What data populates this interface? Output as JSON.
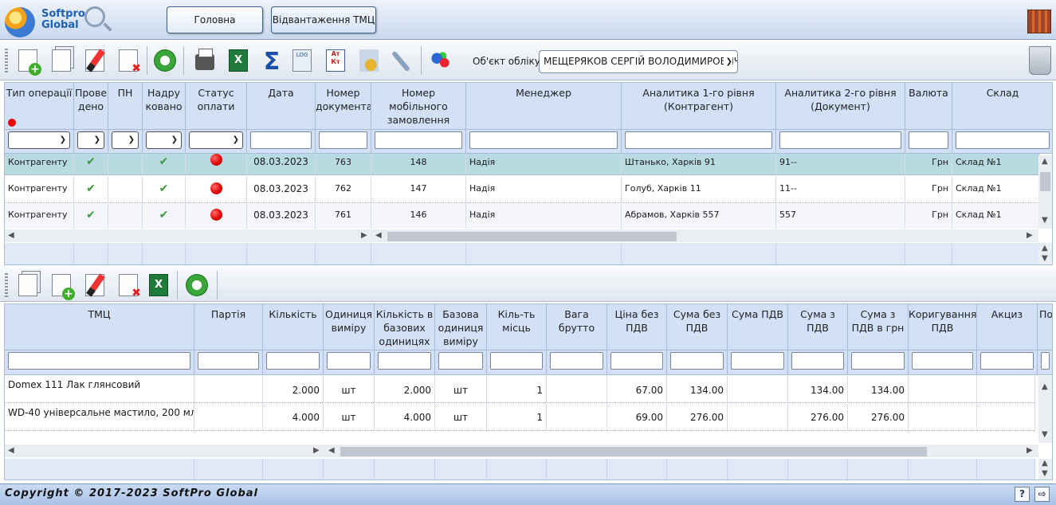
{
  "header": {
    "logo_line1": "Softpro",
    "logo_line2": "Global",
    "tabs": [
      {
        "label": "Головна"
      },
      {
        "label": "Відвантаження ТМЦ"
      }
    ]
  },
  "object_selector": {
    "label": "Об'єкт обліку",
    "value": "МЕЩЕРЯКОВ СЕРГІЙ ВОЛОДИМИРОВИЧ"
  },
  "grid1": {
    "columns": [
      "Тип операції",
      "Прове дено",
      "ПН",
      "Надру ковано",
      "Статус оплати",
      "Дата",
      "Номер документа",
      "Номер мобільного замовлення",
      "Менеджер",
      "Аналитика 1-го рівня (Контрагент)",
      "Аналитика 2-го рівня (Документ)",
      "Валюта",
      "Склад"
    ],
    "rows": [
      {
        "type": "Контрагенту",
        "date": "08.03.2023",
        "doc_no": "763",
        "mobile_no": "148",
        "manager": "Надія",
        "analytics1": "Штанько, Харків 91",
        "analytics2": "91--",
        "currency": "Грн",
        "warehouse": "Склад №1"
      },
      {
        "type": "Контрагенту",
        "date": "08.03.2023",
        "doc_no": "762",
        "mobile_no": "147",
        "manager": "Надія",
        "analytics1": "Голуб, Харків 11",
        "analytics2": "11--",
        "currency": "Грн",
        "warehouse": "Склад №1"
      },
      {
        "type": "Контрагенту",
        "date": "08.03.2023",
        "doc_no": "761",
        "mobile_no": "146",
        "manager": "Надія",
        "analytics1": "Абрамов, Харків 557",
        "analytics2": "557",
        "currency": "Грн",
        "warehouse": "Склад №1"
      }
    ]
  },
  "grid2": {
    "columns": [
      "ТМЦ",
      "Партія",
      "Кількість",
      "Одиниця виміру",
      "Кількість в базових одиницях",
      "Базова одиниця виміру",
      "Кіль-ть місць",
      "Вага брутто",
      "Ціна без ПДВ",
      "Сума без ПДВ",
      "Сума ПДВ",
      "Сума з ПДВ",
      "Сума з ПДВ в грн",
      "Коригування ПДВ",
      "Акциз",
      "По"
    ],
    "rows": [
      {
        "item": "Domex 111 Лак глянсовий",
        "qty": "2.000",
        "unit": "шт",
        "base_qty": "2.000",
        "base_unit": "шт",
        "places": "1",
        "price": "67.00",
        "sum_no_vat": "134.00",
        "sum_vat": "134.00",
        "sum_vat_uah": "134.00"
      },
      {
        "item": "WD-40 універсальне мастило, 200 мл",
        "qty": "4.000",
        "unit": "шт",
        "base_qty": "4.000",
        "base_unit": "шт",
        "places": "1",
        "price": "69.00",
        "sum_no_vat": "276.00",
        "sum_vat": "276.00",
        "sum_vat_uah": "276.00"
      }
    ]
  },
  "footer": {
    "copyright": "Copyright © 2017-2023 SoftPro Global",
    "help_label": "?"
  }
}
